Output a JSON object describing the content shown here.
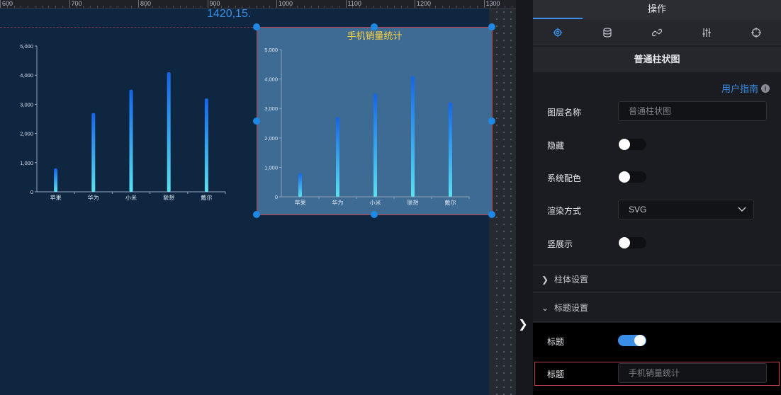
{
  "ruler": {
    "labels": [
      "600",
      "700",
      "800",
      "900",
      "1000",
      "1100",
      "1200",
      "1300"
    ]
  },
  "canvas": {
    "coordinate_readout": "1420,15."
  },
  "chart_data": [
    {
      "type": "bar",
      "title": "",
      "categories": [
        "苹果",
        "华为",
        "小米",
        "联想",
        "戴尔"
      ],
      "values": [
        800,
        2700,
        3500,
        4100,
        3200
      ],
      "yticks": [
        "0",
        "1,000",
        "2,000",
        "3,000",
        "4,000",
        "5,000"
      ],
      "ylim": [
        0,
        5000
      ],
      "colors": {
        "top": "#1565e8",
        "bottom": "#5be0f0"
      }
    },
    {
      "type": "bar",
      "title": "手机销量统计",
      "categories": [
        "苹果",
        "华为",
        "小米",
        "联想",
        "戴尔"
      ],
      "values": [
        800,
        2700,
        3500,
        4100,
        3200
      ],
      "yticks": [
        "0",
        "1,000",
        "2,000",
        "3,000",
        "4,000",
        "5,000"
      ],
      "ylim": [
        0,
        5000
      ],
      "colors": {
        "top": "#1565e8",
        "bottom": "#5be0f0",
        "title": "#ffd23f"
      }
    }
  ],
  "panel": {
    "tab_label": "操作",
    "icons": [
      "settings-icon",
      "database-icon",
      "link-icon",
      "sliders-icon",
      "target-icon"
    ],
    "header": "普通柱状图",
    "guide_link": "用户指南",
    "layer_name_label": "图层名称",
    "layer_name_placeholder": "普通柱状图",
    "hide_label": "隐藏",
    "system_color_label": "系统配色",
    "render_label": "渲染方式",
    "render_value": "SVG",
    "vertical_label": "竖展示",
    "section_bar": "柱体设置",
    "section_title": "标题设置",
    "title_toggle_label": "标题",
    "title_input_label": "标题",
    "title_input_placeholder": "手机销量统计"
  }
}
